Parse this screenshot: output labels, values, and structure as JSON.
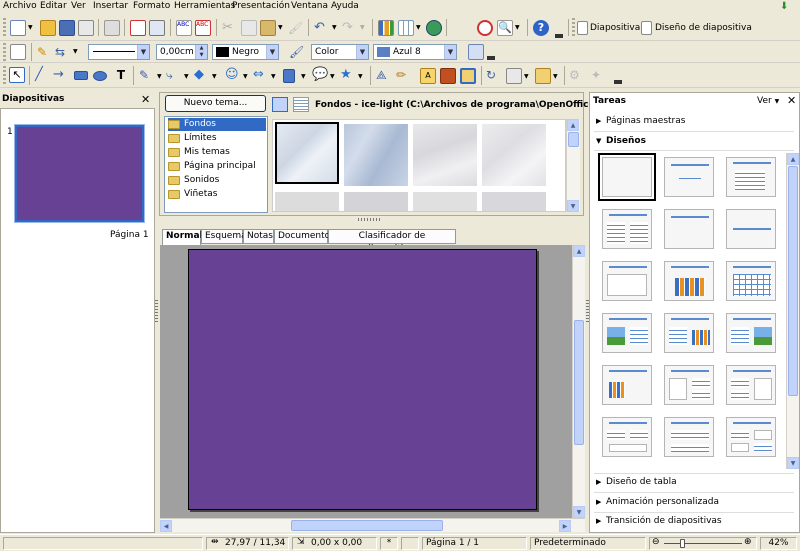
{
  "menu": [
    "Archivo",
    "Editar",
    "Ver",
    "Insertar",
    "Formato",
    "Herramientas",
    "Presentación",
    "Ventana",
    "Ayuda"
  ],
  "toolbar1": {
    "slide_label": "Diapositiva",
    "layout_label": "Diseño de diapositiva"
  },
  "toolbar2": {
    "line_width": "0,00cm",
    "line_color": "Negro",
    "area_style": "Color",
    "area_color": "Azul 8"
  },
  "colors": {
    "slide": "#674193",
    "selection": "#316ac5",
    "hover": "#c1d3fb"
  },
  "slides_pane": {
    "title": "Diapositivas",
    "slide_number": "1",
    "slide_caption": "Página 1"
  },
  "gallery": {
    "new_theme_button": "Nuevo tema...",
    "title": "Fondos - ice-light (C:\\Archivos de programa\\OpenOffice.org",
    "themes": [
      "Fondos",
      "Límites",
      "Mis temas",
      "Página principal",
      "Sonidos",
      "Viñetas"
    ],
    "selected_theme": "Fondos"
  },
  "view_tabs": [
    "Normal",
    "Esquema",
    "Notas",
    "Documento",
    "Clasificador de diapositivas"
  ],
  "active_tab": "Normal",
  "task_pane": {
    "title": "Tareas",
    "view_menu": "Ver",
    "sections": {
      "master_pages": "Páginas maestras",
      "layouts": "Diseños",
      "table_design": "Diseño de tabla",
      "custom_animation": "Animación personalizada",
      "slide_transition": "Transición de diapositivas"
    }
  },
  "status": {
    "position": "27,97 / 11,34",
    "size": "0,00 x 0,00",
    "modified": "*",
    "page": "Página 1 / 1",
    "style": "Predeterminado",
    "zoom": "42%"
  }
}
